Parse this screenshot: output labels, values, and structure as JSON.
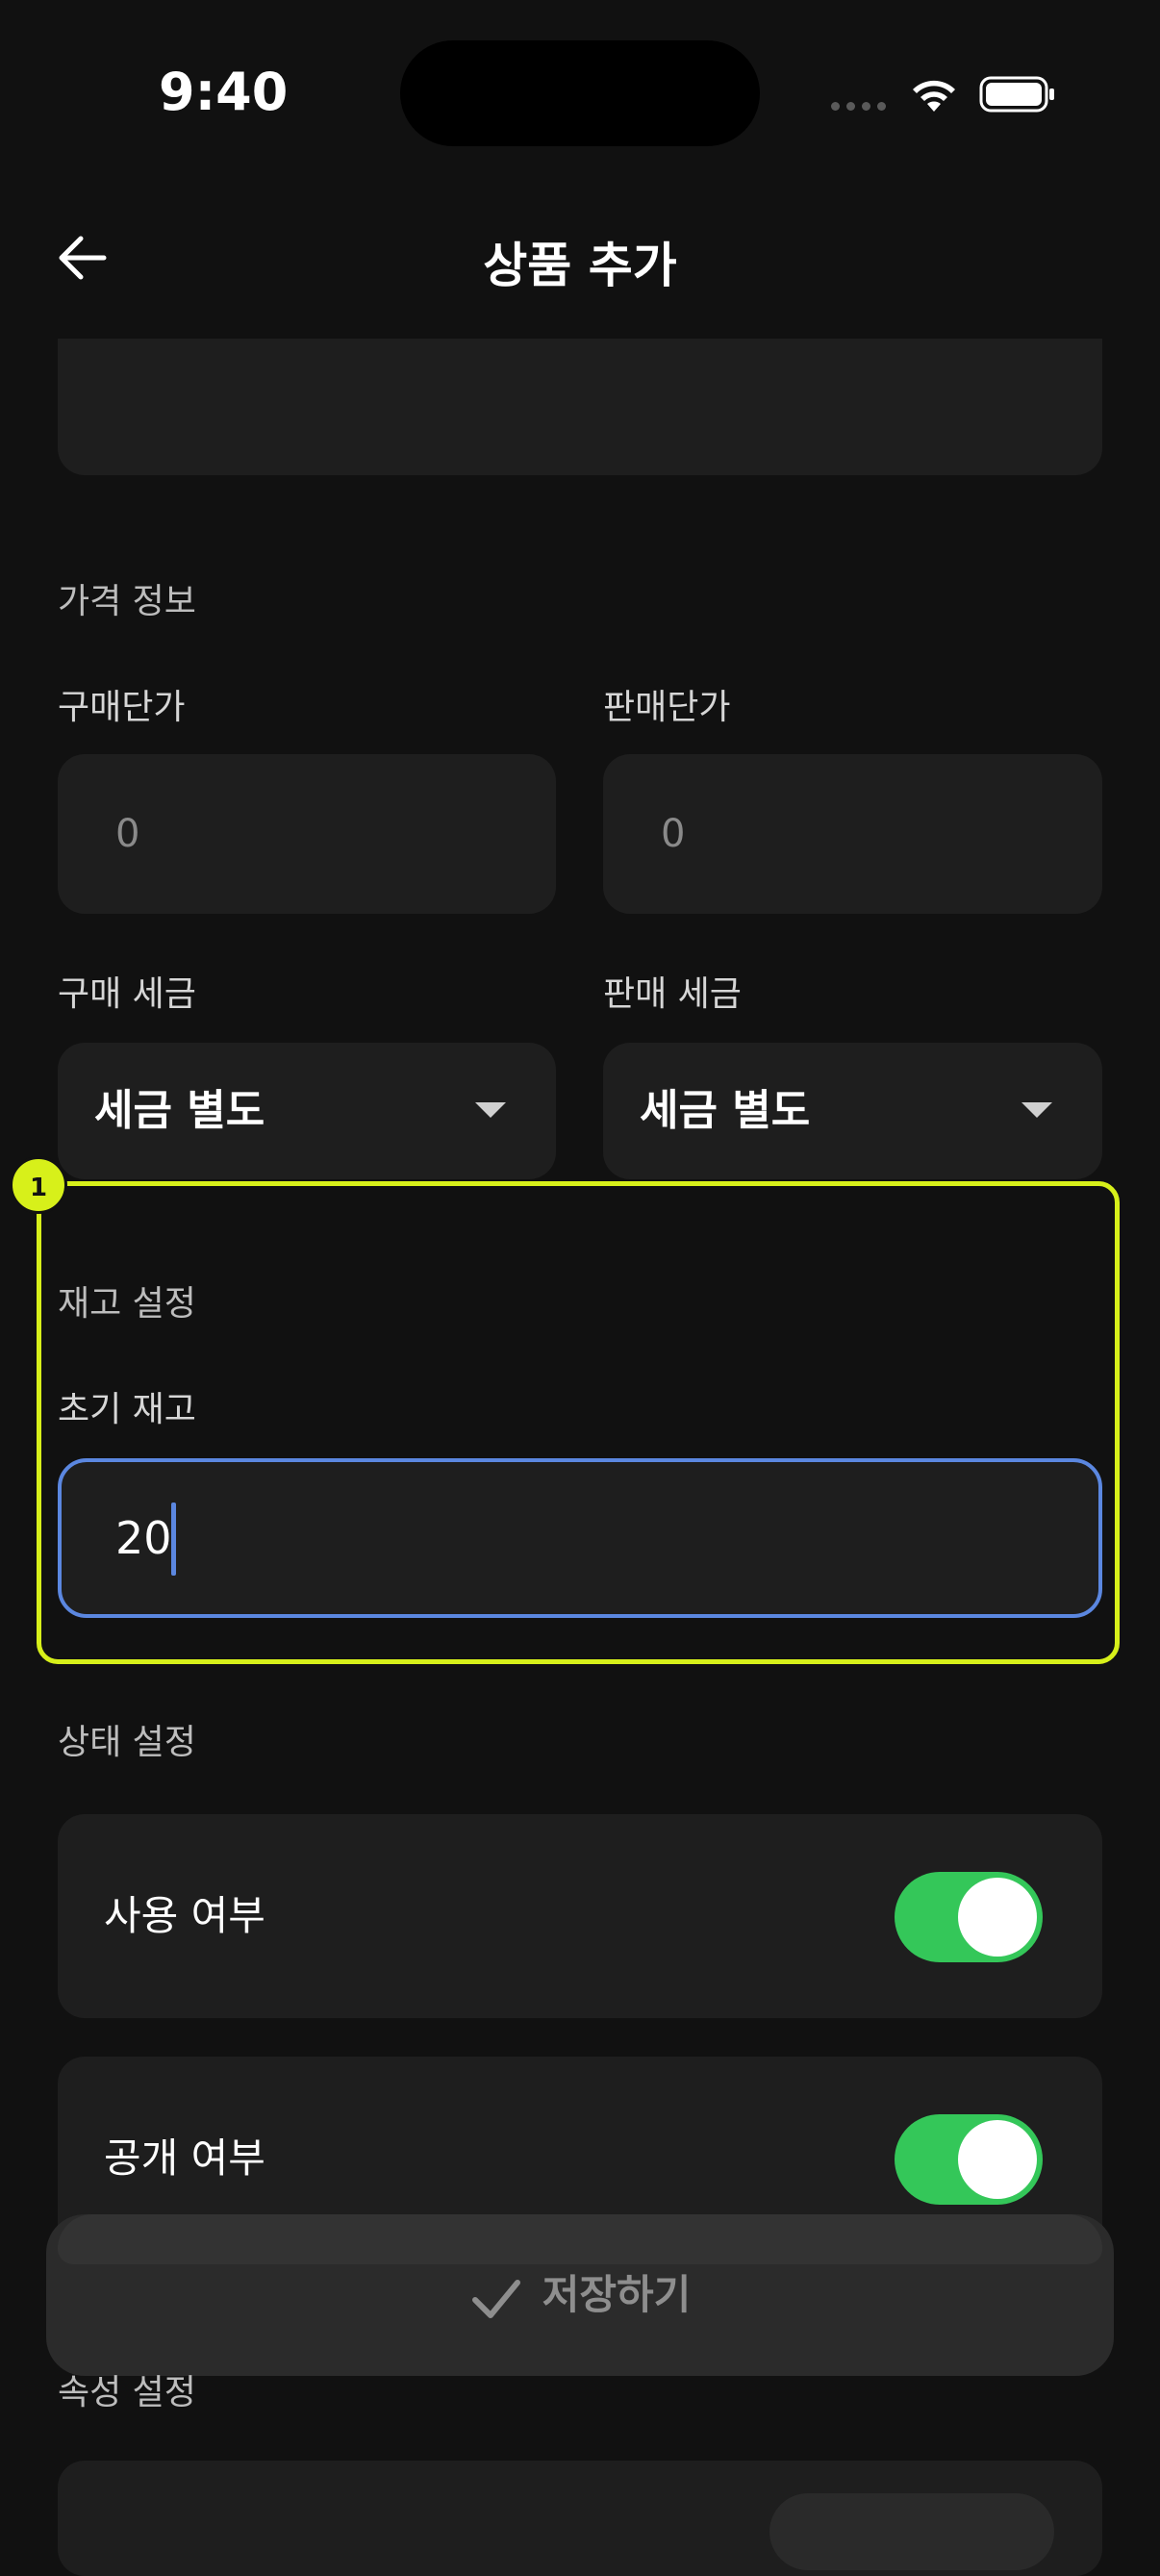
{
  "status_bar": {
    "time": "9:40"
  },
  "header": {
    "title": "상품 추가"
  },
  "price_section": {
    "label": "가격 정보",
    "purchase_price": {
      "label": "구매단가",
      "placeholder": "0"
    },
    "sale_price": {
      "label": "판매단가",
      "placeholder": "0"
    },
    "purchase_tax": {
      "label": "구매 세금",
      "value": "세금 별도"
    },
    "sale_tax": {
      "label": "판매 세금",
      "value": "세금 별도"
    }
  },
  "highlight": {
    "badge": "1",
    "color": "#d7f01a"
  },
  "stock_section": {
    "label": "재고 설정",
    "initial_stock": {
      "label": "초기 재고",
      "value": "20"
    }
  },
  "status_section": {
    "label": "상태 설정",
    "use": {
      "label": "사용 여부",
      "on": true
    },
    "public": {
      "label": "공개 여부",
      "on": true
    }
  },
  "save_button": {
    "label": "저장하기"
  },
  "attribute_section": {
    "label": "속성 설정"
  },
  "colors": {
    "accent": "#5b87e0",
    "toggle_on": "#34c759",
    "background": "#111111"
  },
  "icons": {
    "back": "arrow-left-icon",
    "save": "check-icon",
    "dropdown": "caret-down-icon"
  }
}
